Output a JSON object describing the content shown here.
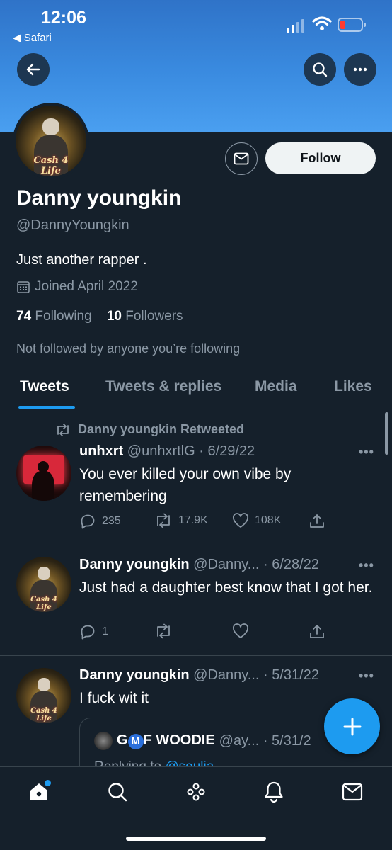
{
  "status_bar": {
    "time": "12:06",
    "back_app": "◀ Safari"
  },
  "icons": {
    "back": "arrow-left-icon",
    "search": "search-icon",
    "more": "more-icon",
    "message": "envelope-icon",
    "calendar": "calendar-icon",
    "reply": "reply-icon",
    "retweet": "retweet-icon",
    "like": "heart-icon",
    "share": "share-icon",
    "compose": "plus-icon",
    "home": "home-icon",
    "explore": "search-icon",
    "spaces": "spaces-icon",
    "notifications": "bell-icon",
    "messages": "envelope-icon"
  },
  "colors": {
    "accent": "#1d9bf0",
    "background": "#15202b",
    "muted": "#8b98a5",
    "banner": "#3a8be0"
  },
  "profile": {
    "avatar_text": "Cash 4 Life",
    "follow_label": "Follow",
    "display_name": "Danny youngkin",
    "handle": "@DannyYoungkin",
    "bio": "Just another rapper .",
    "joined": "Joined April 2022",
    "following_count": "74",
    "following_label": "Following",
    "followers_count": "10",
    "followers_label": "Followers",
    "not_followed": "Not followed by anyone you’re following"
  },
  "tabs": [
    {
      "label": "Tweets",
      "active": true
    },
    {
      "label": "Tweets & replies",
      "active": false
    },
    {
      "label": "Media",
      "active": false
    },
    {
      "label": "Likes",
      "active": false
    }
  ],
  "tweets": [
    {
      "retweet_label": "Danny youngkin Retweeted",
      "name": "unhxrt",
      "meta": "@unhxrtlG · 6/29/22",
      "text": "You ever killed your own vibe by remembering",
      "replies": "235",
      "retweets": "17.9K",
      "likes": "108K"
    },
    {
      "name": "Danny youngkin",
      "meta": "@Danny... · 6/28/22",
      "text": "Just had a daughter best know that I got her.",
      "replies": "1"
    },
    {
      "name": "Danny youngkin",
      "meta": "@Danny... · 5/31/22",
      "text": "I fuck wit it",
      "quote": {
        "name_pre": "G",
        "badge": "M",
        "name_post": "F WOODIE",
        "meta": "@ay... · 5/31/2",
        "reply_prefix": "Replying to",
        "reply_to": "@soulja..."
      }
    }
  ]
}
